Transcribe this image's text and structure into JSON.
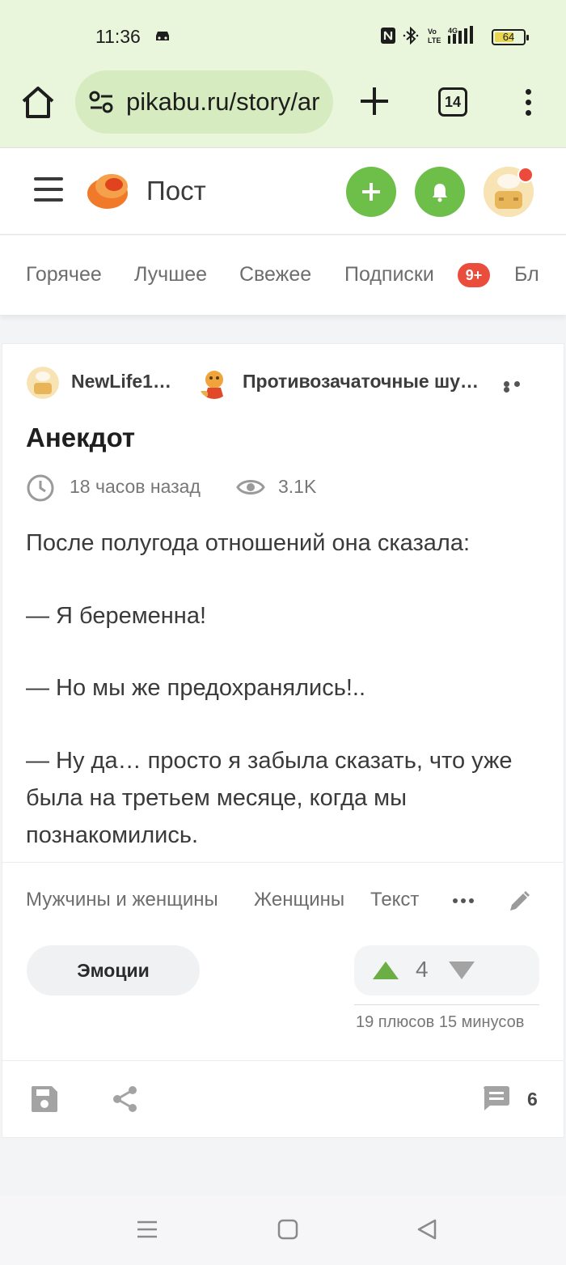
{
  "status_bar": {
    "time": "11:36",
    "battery": "64"
  },
  "browser": {
    "url": "pikabu.ru/story/ar",
    "tab_count": "14"
  },
  "site_header": {
    "page_title": "Пост"
  },
  "feed_tabs": {
    "items": [
      "Горячее",
      "Лучшее",
      "Свежее",
      "Подписки",
      "Бл"
    ],
    "badge": "9+"
  },
  "post": {
    "author": "NewLife1…",
    "community": "Противозачаточные шу…",
    "title": "Анекдот",
    "time_ago": "18 часов назад",
    "views": "3.1K",
    "paragraphs": [
      "После полугода отношений она сказала:",
      "— Я беременна!",
      "— Но мы же предохранялись!..",
      "— Ну да… просто я забыла сказать, что уже была на третьем месяце, когда мы познакомились."
    ],
    "tags": [
      "Мужчины и женщины",
      "Женщины",
      "Текст"
    ],
    "emotions_label": "Эмоции",
    "rating": "4",
    "rating_stats": "19 плюсов 15 минусов",
    "comment_count": "6"
  },
  "colors": {
    "chrome_bg": "#eaf6dc",
    "accent_green": "#6dbf4a",
    "badge_red": "#eb4d3d",
    "logo_orange": "#f07a2a"
  }
}
